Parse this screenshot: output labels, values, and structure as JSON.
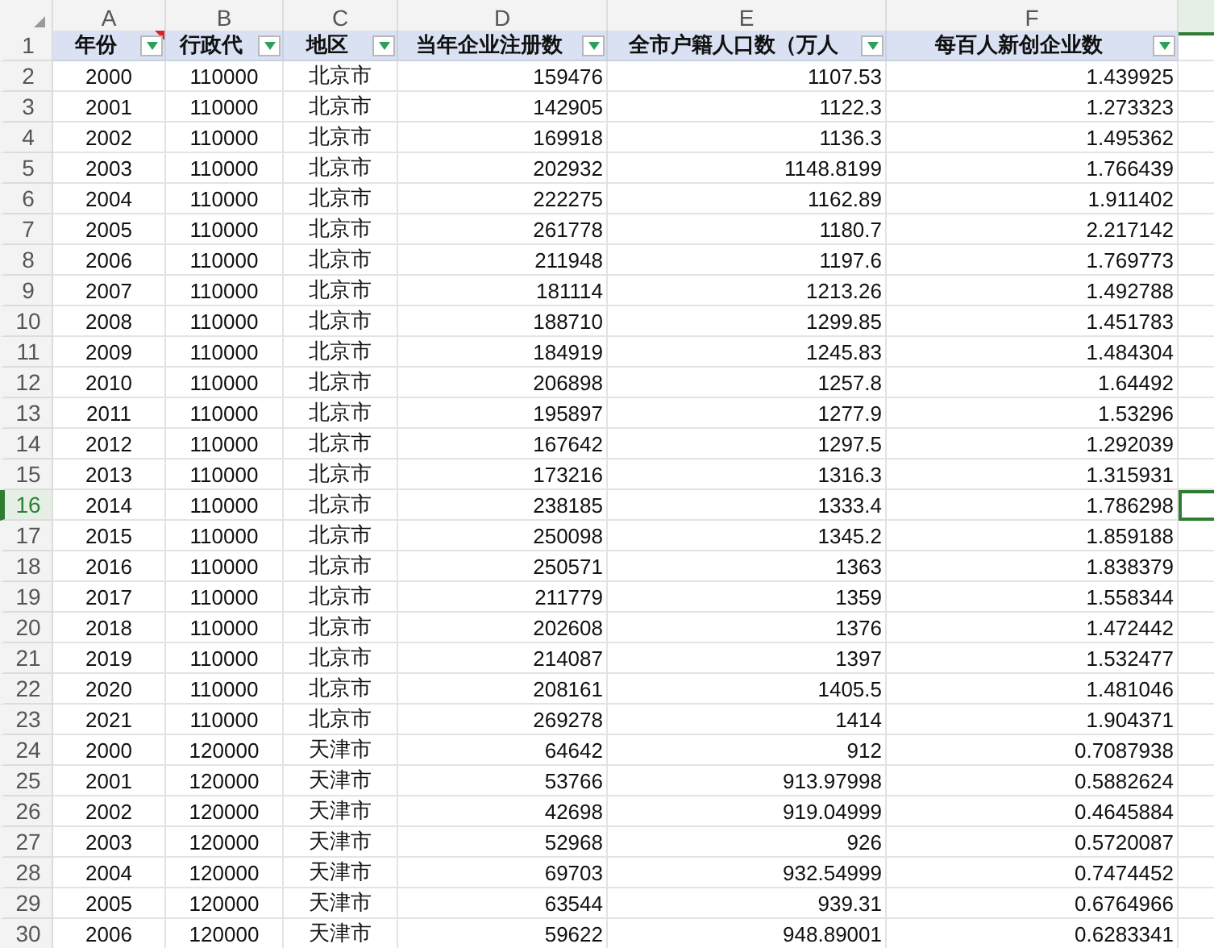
{
  "columns": [
    {
      "letter": "A",
      "selected": false
    },
    {
      "letter": "B",
      "selected": false
    },
    {
      "letter": "C",
      "selected": false
    },
    {
      "letter": "D",
      "selected": false
    },
    {
      "letter": "E",
      "selected": false
    },
    {
      "letter": "F",
      "selected": false
    },
    {
      "selected": true
    }
  ],
  "header_row": {
    "row": "1",
    "cells": [
      {
        "text": "年份",
        "has_comment": true
      },
      {
        "text": "行政代",
        "has_comment": false
      },
      {
        "text": "地区",
        "has_comment": false
      },
      {
        "text": "当年企业注册数",
        "has_comment": false
      },
      {
        "text": "全市户籍人口数（万人",
        "has_comment": false
      },
      {
        "text": "每百人新创企业数",
        "has_comment": false
      }
    ]
  },
  "rows": [
    {
      "row": "2",
      "selected": false,
      "cells": [
        "2000",
        "110000",
        "北京市",
        "159476",
        "1107.53",
        "1.439925"
      ]
    },
    {
      "row": "3",
      "selected": false,
      "cells": [
        "2001",
        "110000",
        "北京市",
        "142905",
        "1122.3",
        "1.273323"
      ]
    },
    {
      "row": "4",
      "selected": false,
      "cells": [
        "2002",
        "110000",
        "北京市",
        "169918",
        "1136.3",
        "1.495362"
      ]
    },
    {
      "row": "5",
      "selected": false,
      "cells": [
        "2003",
        "110000",
        "北京市",
        "202932",
        "1148.8199",
        "1.766439"
      ]
    },
    {
      "row": "6",
      "selected": false,
      "cells": [
        "2004",
        "110000",
        "北京市",
        "222275",
        "1162.89",
        "1.911402"
      ]
    },
    {
      "row": "7",
      "selected": false,
      "cells": [
        "2005",
        "110000",
        "北京市",
        "261778",
        "1180.7",
        "2.217142"
      ]
    },
    {
      "row": "8",
      "selected": false,
      "cells": [
        "2006",
        "110000",
        "北京市",
        "211948",
        "1197.6",
        "1.769773"
      ]
    },
    {
      "row": "9",
      "selected": false,
      "cells": [
        "2007",
        "110000",
        "北京市",
        "181114",
        "1213.26",
        "1.492788"
      ]
    },
    {
      "row": "10",
      "selected": false,
      "cells": [
        "2008",
        "110000",
        "北京市",
        "188710",
        "1299.85",
        "1.451783"
      ]
    },
    {
      "row": "11",
      "selected": false,
      "cells": [
        "2009",
        "110000",
        "北京市",
        "184919",
        "1245.83",
        "1.484304"
      ]
    },
    {
      "row": "12",
      "selected": false,
      "cells": [
        "2010",
        "110000",
        "北京市",
        "206898",
        "1257.8",
        "1.64492"
      ]
    },
    {
      "row": "13",
      "selected": false,
      "cells": [
        "2011",
        "110000",
        "北京市",
        "195897",
        "1277.9",
        "1.53296"
      ]
    },
    {
      "row": "14",
      "selected": false,
      "cells": [
        "2012",
        "110000",
        "北京市",
        "167642",
        "1297.5",
        "1.292039"
      ]
    },
    {
      "row": "15",
      "selected": false,
      "cells": [
        "2013",
        "110000",
        "北京市",
        "173216",
        "1316.3",
        "1.315931"
      ]
    },
    {
      "row": "16",
      "selected": true,
      "cells": [
        "2014",
        "110000",
        "北京市",
        "238185",
        "1333.4",
        "1.786298"
      ]
    },
    {
      "row": "17",
      "selected": false,
      "cells": [
        "2015",
        "110000",
        "北京市",
        "250098",
        "1345.2",
        "1.859188"
      ]
    },
    {
      "row": "18",
      "selected": false,
      "cells": [
        "2016",
        "110000",
        "北京市",
        "250571",
        "1363",
        "1.838379"
      ]
    },
    {
      "row": "19",
      "selected": false,
      "cells": [
        "2017",
        "110000",
        "北京市",
        "211779",
        "1359",
        "1.558344"
      ]
    },
    {
      "row": "20",
      "selected": false,
      "cells": [
        "2018",
        "110000",
        "北京市",
        "202608",
        "1376",
        "1.472442"
      ]
    },
    {
      "row": "21",
      "selected": false,
      "cells": [
        "2019",
        "110000",
        "北京市",
        "214087",
        "1397",
        "1.532477"
      ]
    },
    {
      "row": "22",
      "selected": false,
      "cells": [
        "2020",
        "110000",
        "北京市",
        "208161",
        "1405.5",
        "1.481046"
      ]
    },
    {
      "row": "23",
      "selected": false,
      "cells": [
        "2021",
        "110000",
        "北京市",
        "269278",
        "1414",
        "1.904371"
      ]
    },
    {
      "row": "24",
      "selected": false,
      "cells": [
        "2000",
        "120000",
        "天津市",
        "64642",
        "912",
        "0.7087938"
      ]
    },
    {
      "row": "25",
      "selected": false,
      "cells": [
        "2001",
        "120000",
        "天津市",
        "53766",
        "913.97998",
        "0.5882624"
      ]
    },
    {
      "row": "26",
      "selected": false,
      "cells": [
        "2002",
        "120000",
        "天津市",
        "42698",
        "919.04999",
        "0.4645884"
      ]
    },
    {
      "row": "27",
      "selected": false,
      "cells": [
        "2003",
        "120000",
        "天津市",
        "52968",
        "926",
        "0.5720087"
      ]
    },
    {
      "row": "28",
      "selected": false,
      "cells": [
        "2004",
        "120000",
        "天津市",
        "69703",
        "932.54999",
        "0.7474452"
      ]
    },
    {
      "row": "29",
      "selected": false,
      "cells": [
        "2005",
        "120000",
        "天津市",
        "63544",
        "939.31",
        "0.6764966"
      ]
    },
    {
      "row": "30",
      "selected": false,
      "cells": [
        "2006",
        "120000",
        "天津市",
        "59622",
        "948.89001",
        "0.6283341"
      ]
    }
  ]
}
